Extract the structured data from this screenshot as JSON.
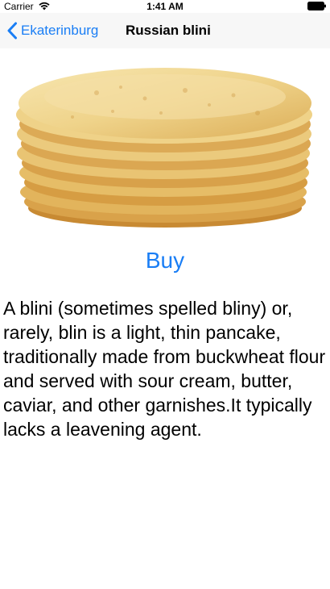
{
  "status_bar": {
    "carrier": "Carrier",
    "time": "1:41 AM",
    "icons": [
      "wifi-icon",
      "battery-icon"
    ]
  },
  "nav": {
    "back_label": "Ekaterinburg",
    "title": "Russian blini",
    "back_icon": "chevron-left-icon"
  },
  "main": {
    "image": "stack-of-blini-pancakes",
    "buy_label": "Buy",
    "description": "A blini (sometimes spelled bliny) or, rarely, blin is a light, thin pancake, traditionally made from buckwheat flour and served with sour cream, butter, caviar, and other garnishes.It typically lacks a leavening agent."
  },
  "colors": {
    "accent": "#1a7ef5",
    "navbar_bg": "#f7f7f7"
  }
}
